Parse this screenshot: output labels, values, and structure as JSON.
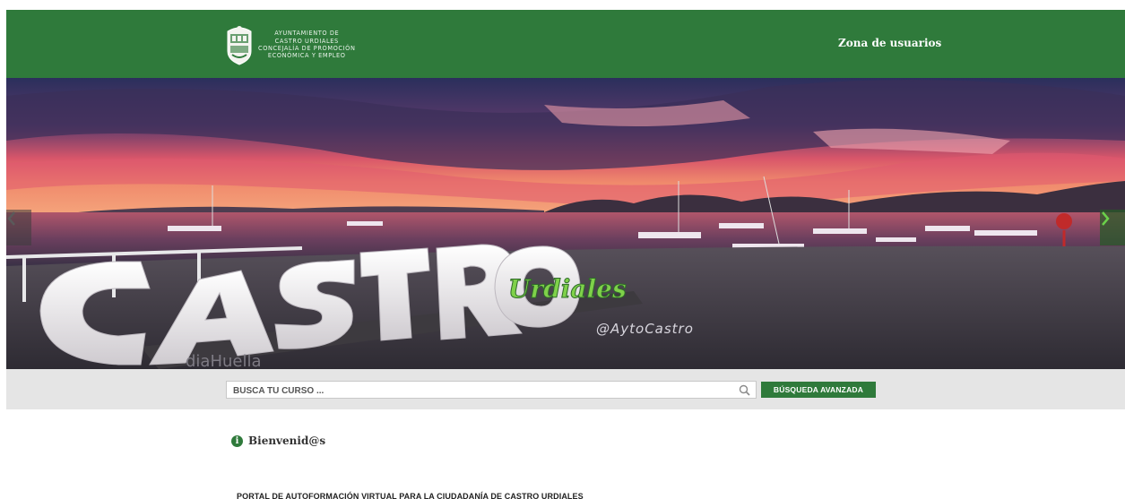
{
  "header": {
    "logo_lines": [
      "AYUNTAMIENTO DE",
      "CASTRO URDIALES",
      "CONCEJALÍA DE PROMOCIÓN",
      "ECONÓMICA Y EMPLEO"
    ],
    "user_zone_label": "Zona de usuarios"
  },
  "hero": {
    "sign_text": "CASTRO",
    "sign_script": "Urdiales",
    "watermark": "@AytoCastro",
    "ground_text": "diaHuella",
    "prev_icon": "chevron-left-icon",
    "next_icon": "chevron-right-icon"
  },
  "search": {
    "placeholder": "BUSCA TU CURSO ...",
    "value": "",
    "advanced_label": "BÚSQUEDA AVANZADA",
    "icon": "search-icon"
  },
  "content": {
    "welcome": "Bienvenid@s",
    "info_glyph": "i",
    "portal_title": "PORTAL DE AUTOFORMACIÓN VIRTUAL PARA LA CIUDADANÍA DE CASTRO URDIALES"
  },
  "colors": {
    "brand_green": "#2f7a3b",
    "search_band": "#e5e5e5"
  }
}
